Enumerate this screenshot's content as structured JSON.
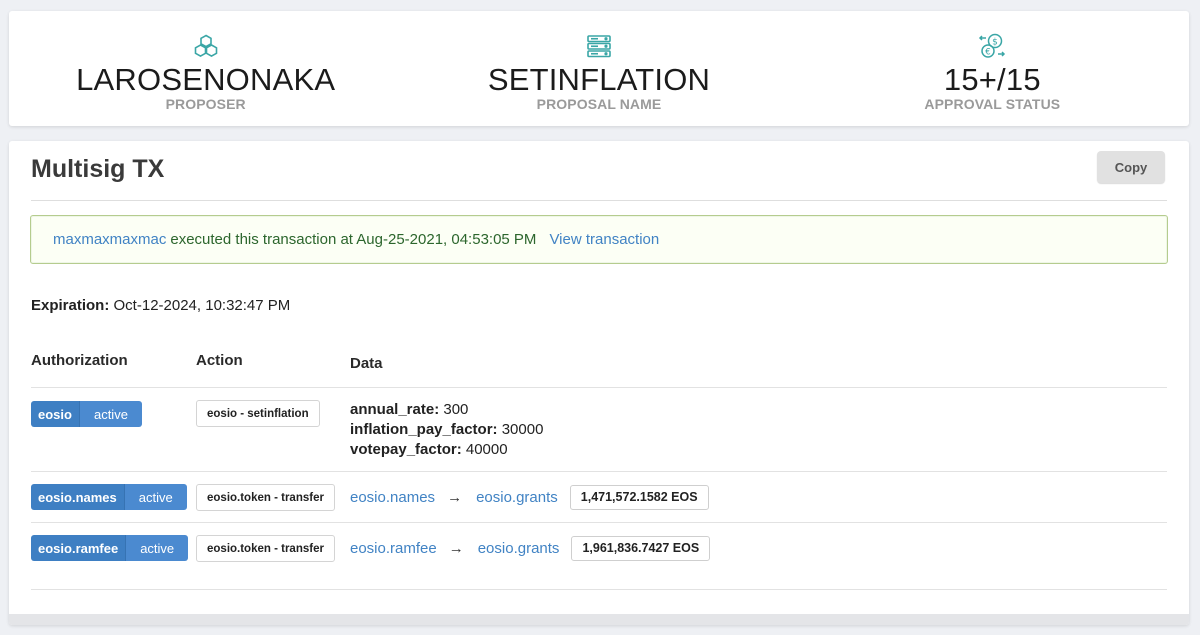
{
  "header": {
    "proposer": {
      "value": "LAROSENONAKA",
      "label": "PROPOSER",
      "icon": "hexagon-cluster-icon"
    },
    "proposal_name": {
      "value": "SETINFLATION",
      "label": "PROPOSAL NAME",
      "icon": "server-stack-icon"
    },
    "approval_status": {
      "value": "15+/15",
      "label": "APPROVAL STATUS",
      "icon": "currency-exchange-icon"
    }
  },
  "main": {
    "title": "Multisig TX",
    "copy_label": "Copy",
    "notice": {
      "account": "maxmaxmaxmac",
      "text": "executed this transaction at Aug-25-2021, 04:53:05 PM",
      "link": "View transaction"
    },
    "expiration": {
      "label": "Expiration:",
      "value": "Oct-12-2024, 10:32:47 PM"
    },
    "table": {
      "headers": {
        "authorization": "Authorization",
        "action": "Action",
        "data": "Data"
      },
      "rows": [
        {
          "actor": "eosio",
          "permission": "active",
          "action": "eosio - setinflation",
          "fields": [
            {
              "key": "annual_rate:",
              "value": "300"
            },
            {
              "key": "inflation_pay_factor:",
              "value": "30000"
            },
            {
              "key": "votepay_factor:",
              "value": "40000"
            }
          ]
        },
        {
          "actor": "eosio.names",
          "permission": "active",
          "action": "eosio.token - transfer",
          "from": "eosio.names",
          "arrow": "→",
          "to": "eosio.grants",
          "amount": "1,471,572.1582 EOS"
        },
        {
          "actor": "eosio.ramfee",
          "permission": "active",
          "action": "eosio.token - transfer",
          "from": "eosio.ramfee",
          "arrow": "→",
          "to": "eosio.grants",
          "amount": "1,961,836.7427 EOS"
        }
      ]
    }
  },
  "colors": {
    "accent": "#4183c4",
    "badge": "#3e7fc3",
    "success_text": "#2c662d",
    "success_border": "#b5cc8e",
    "icon": "#3aa6a6"
  }
}
